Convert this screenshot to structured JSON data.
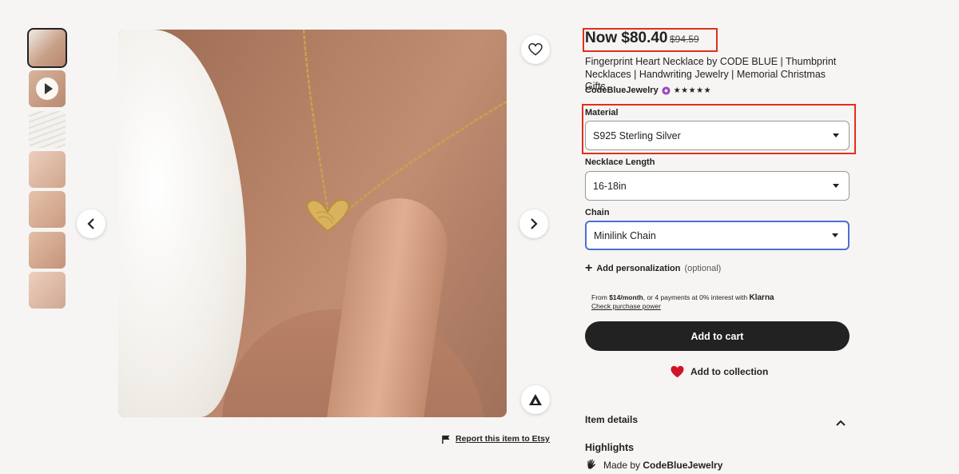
{
  "top_links": [
    "",
    "",
    ""
  ],
  "gallery": {
    "thumbnails": [
      {
        "label": "thumbnail-1"
      },
      {
        "label": "thumbnail-2-video"
      },
      {
        "label": "thumbnail-3"
      },
      {
        "label": "thumbnail-4"
      },
      {
        "label": "thumbnail-5"
      },
      {
        "label": "thumbnail-6"
      },
      {
        "label": "thumbnail-7"
      }
    ],
    "prev_icon": "chevron-left-icon",
    "next_icon": "chevron-right-icon",
    "favorite_icon": "heart-outline-icon"
  },
  "report_label": "Report this item to Etsy",
  "product": {
    "price_now": "Now $80.40",
    "price_original": "$94.59",
    "title": "Fingerprint Heart Necklace by CODE BLUE | Thumbprint Necklaces | Handwriting Jewelry | Memorial Christmas Gifts",
    "shop_name": "CodeBlueJewelry",
    "stars": "★★★★★",
    "star_rating": 5
  },
  "options": {
    "material": {
      "label": "Material",
      "value": "S925 Sterling Silver"
    },
    "length": {
      "label": "Necklace Length",
      "value": "16-18in"
    },
    "chain": {
      "label": "Chain",
      "value": "Minilink Chain"
    }
  },
  "personalization": {
    "label": "Add personalization",
    "optional": "(optional)"
  },
  "klarna": {
    "prefix": "From ",
    "amount": "$14/month",
    "middle": ", or 4 payments at 0% interest with ",
    "brand": "Klarna",
    "link": "Check purchase power"
  },
  "actions": {
    "add_to_cart": "Add to cart",
    "add_to_collection": "Add to collection"
  },
  "details": {
    "item_details": "Item details",
    "highlights": "Highlights",
    "made_by_prefix": "Made by ",
    "made_by_shop": "CodeBlueJewelry"
  },
  "colors": {
    "accent_red": "#e0301e",
    "focus_blue": "#4d6fd6",
    "button_dark": "#222222",
    "heart_red": "#d0142a"
  }
}
